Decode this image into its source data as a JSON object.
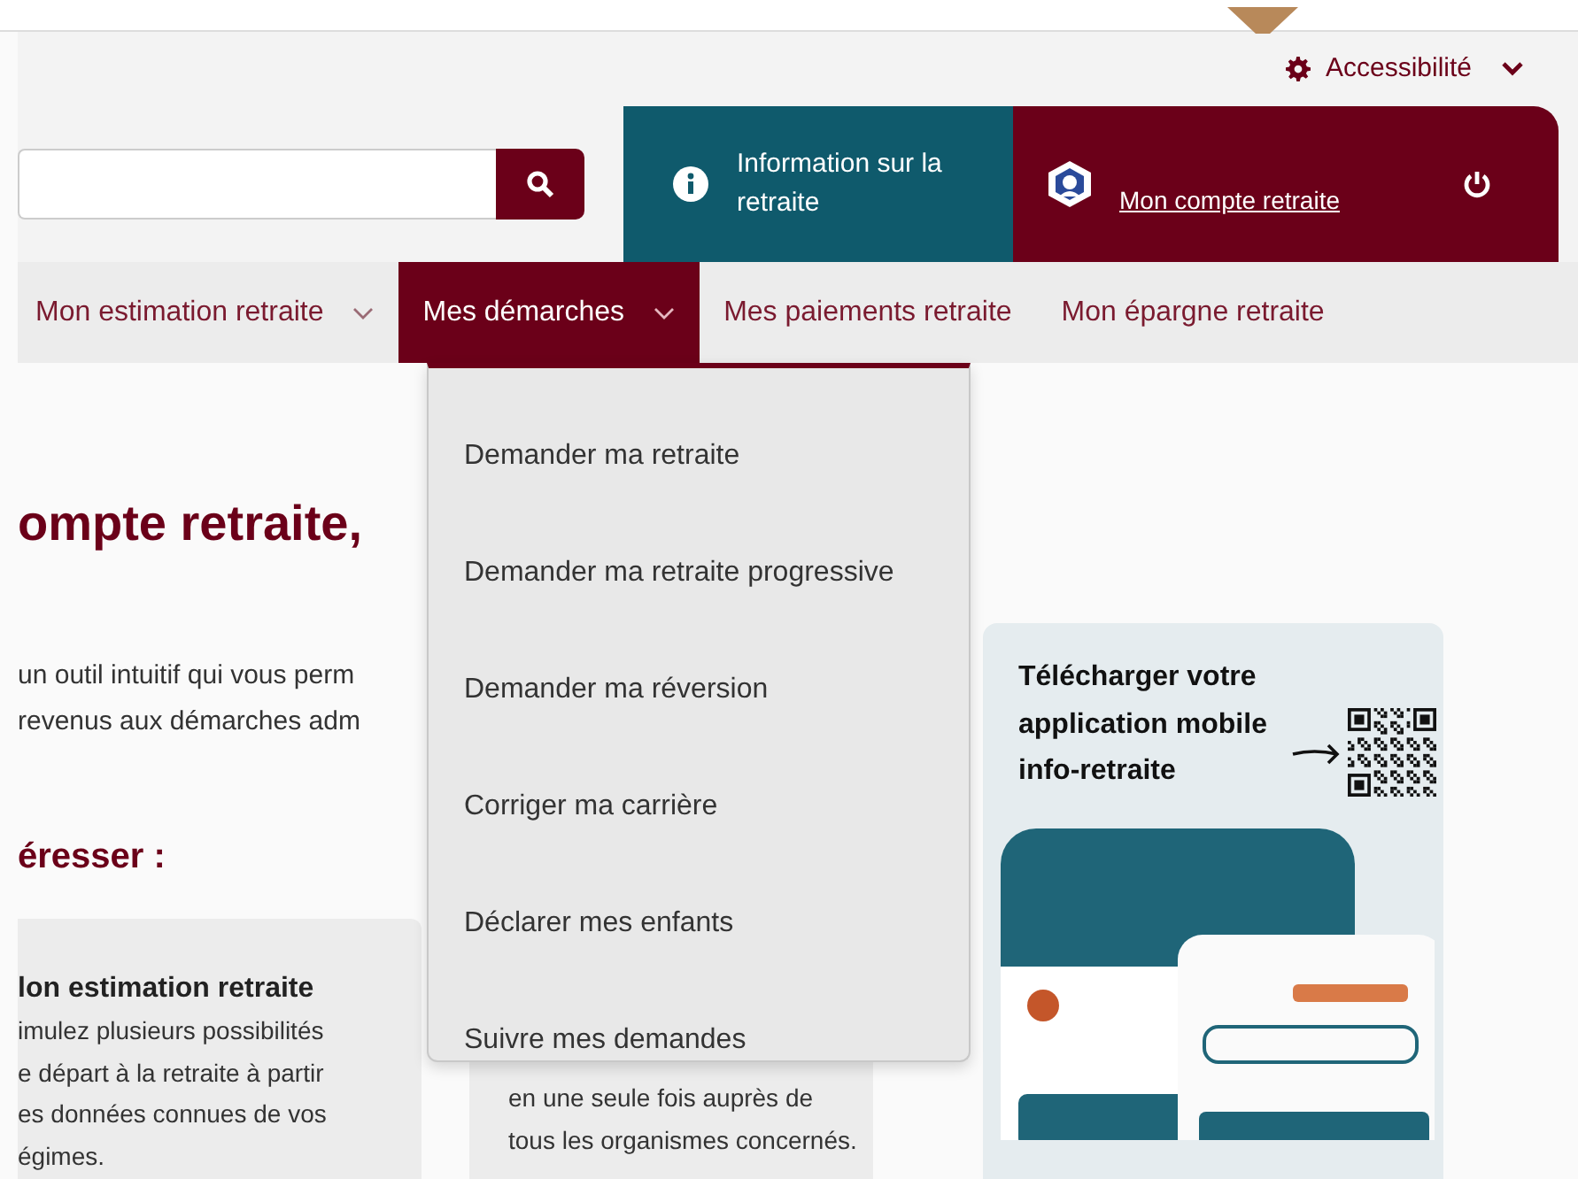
{
  "top_bar": {
    "accessibility": "Accessibilité"
  },
  "info_tile": {
    "label": "Information sur la retraite"
  },
  "account_tile": {
    "link": "Mon compte retraite"
  },
  "nav": [
    {
      "label": "Mon estimation retraite",
      "has_menu": true,
      "selected": false
    },
    {
      "label": "Mes démarches",
      "has_menu": true,
      "selected": true
    },
    {
      "label": "Mes paiements retraite",
      "has_menu": false,
      "selected": false
    },
    {
      "label": "Mon épargne retraite",
      "has_menu": false,
      "selected": false
    }
  ],
  "dropdown": {
    "items": [
      "Demander ma retraite",
      "Demander ma retraite progressive",
      "Demander ma réversion",
      "Corriger ma carrière",
      "Déclarer mes enfants",
      "Suivre mes demandes"
    ]
  },
  "content": {
    "heading": "ompte retraite,",
    "intro_lines": [
      "un outil intuitif qui vous perm",
      "revenus aux démarches adm"
    ],
    "subheading": "éresser :",
    "cards": [
      {
        "title": "lon estimation retraite",
        "lines": [
          "imulez plusieurs possibilités",
          "e départ à la retraite à partir",
          "es données connues de vos",
          "égimes."
        ]
      },
      {
        "lines": [
          "en une seule fois auprès de",
          "tous les organismes concernés."
        ]
      }
    ]
  },
  "app_promo": {
    "title": "Télécharger votre application mobile info-retraite"
  }
}
